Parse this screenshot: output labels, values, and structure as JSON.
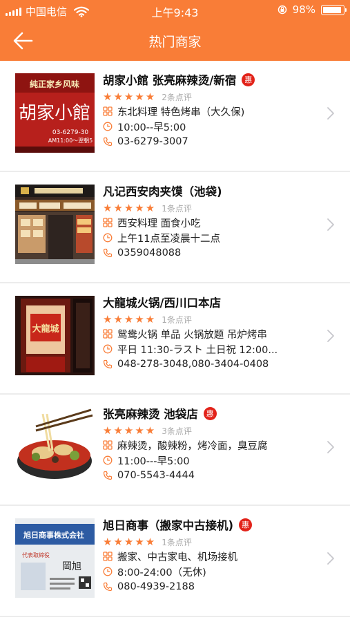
{
  "status_bar": {
    "carrier": "中国电信",
    "time": "上午9:43",
    "battery": "98%",
    "battery_level": 0.98
  },
  "nav": {
    "title": "热门商家"
  },
  "colors": {
    "accent": "#f97d37",
    "badge": "#e2231a"
  },
  "merchants": [
    {
      "name": "胡家小館 张亮麻辣烫/新宿",
      "badge": "惠",
      "rating": 5,
      "reviews": "2条点评",
      "category": "东北料理 特色烤串（大久保)",
      "hours": "10:00--早5:00",
      "phone": "03-6279-3007",
      "thumb": {
        "banner": "純正家乡风味",
        "sign": "胡家小館",
        "tel": "03-6279-30",
        "hours": "AM11:00～翌朝5"
      }
    },
    {
      "name": "凡记西安肉夹馍（池袋)",
      "badge": "",
      "rating": 5,
      "reviews": "1条点评",
      "category": "西安料理 面食小吃",
      "hours": "上午11点至凌晨十二点",
      "phone": "0359048088",
      "thumb": {}
    },
    {
      "name": "大龍城火锅/西川口本店",
      "badge": "",
      "rating": 5,
      "reviews": "1条点评",
      "category": "鸳鸯火锅 单品 火锅放题 吊炉烤串",
      "hours": "平日 11:30-ラスト 土日祝 12:00...",
      "phone": "048-278-3048,080-3404-0408",
      "thumb": {
        "sign": "大龍城"
      }
    },
    {
      "name": "张亮麻辣烫 池袋店",
      "badge": "惠",
      "rating": 5,
      "reviews": "3条点评",
      "category": "麻辣烫，酸辣粉，烤冷面，臭豆腐",
      "hours": "11:00---早5:00",
      "phone": "070-5543-4444",
      "thumb": {}
    },
    {
      "name": "旭日商事（搬家中古接机)",
      "badge": "惠",
      "rating": 5,
      "reviews": "1条点评",
      "category": "搬家、中古家电、机场接机",
      "hours": "8:00-24:00（无休)",
      "phone": "080-4939-2188",
      "thumb": {
        "sign": "旭日商事株式会社",
        "sub": "代表取締役",
        "name": "岡旭"
      }
    }
  ]
}
